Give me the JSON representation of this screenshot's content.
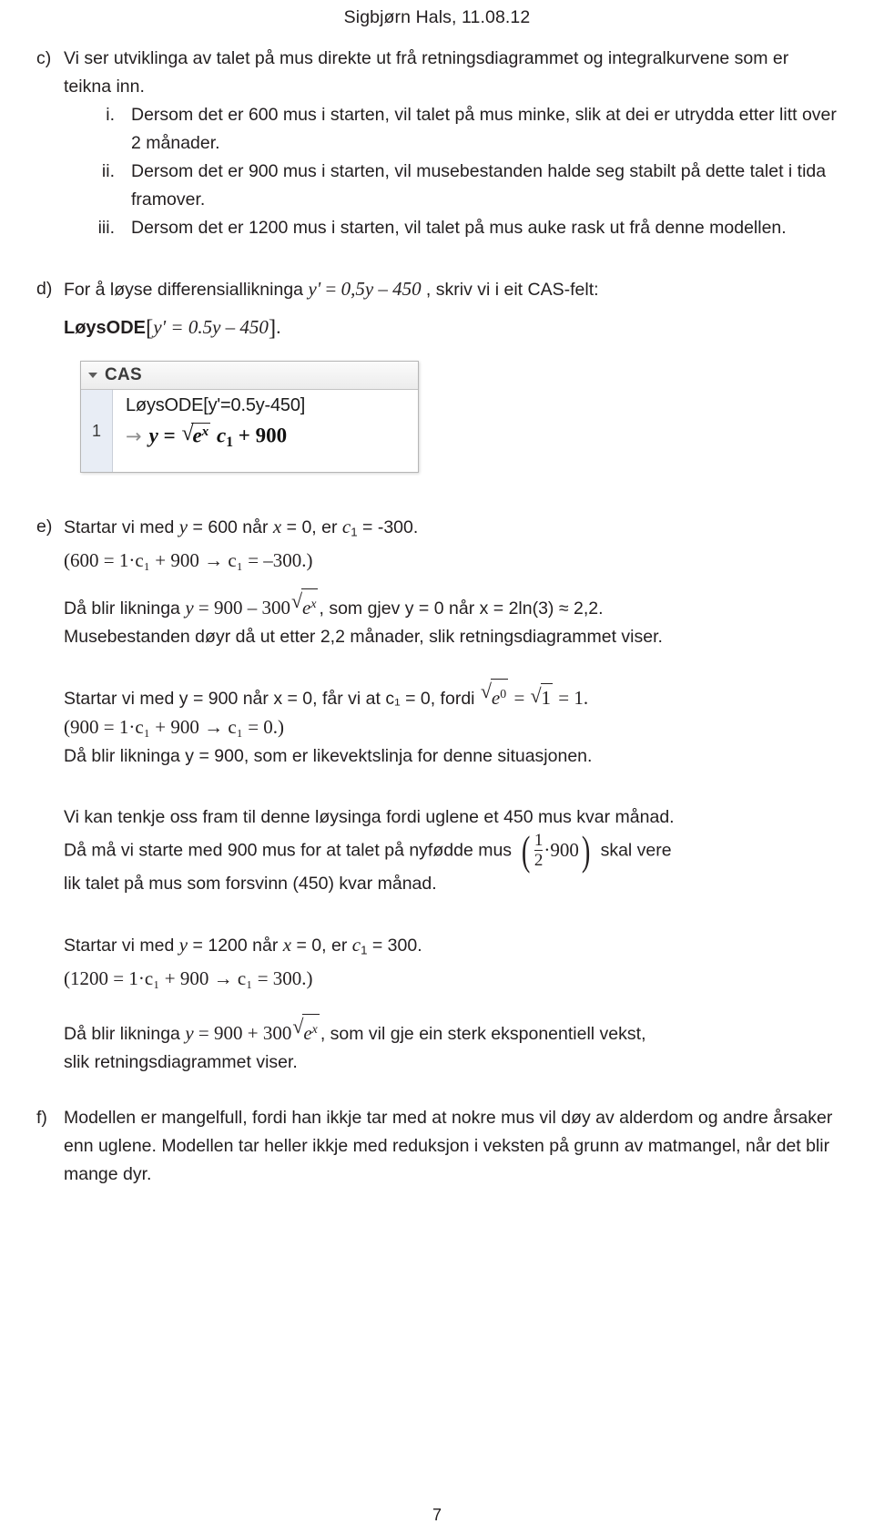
{
  "header": {
    "author_date": "Sigbjørn Hals, 11.08.12"
  },
  "sections": {
    "c": {
      "marker": "c)",
      "intro": "Vi ser utviklinga av talet på mus direkte ut frå retningsdiagrammet og integralkurvene som er teikna inn.",
      "items": [
        {
          "marker": "i.",
          "text": "Dersom det er 600 mus i starten, vil talet på mus minke, slik at dei er utrydda etter litt over 2 månader."
        },
        {
          "marker": "ii.",
          "text": "Dersom det er 900 mus i starten, vil musebestanden halde seg stabilt på dette talet i tida framover."
        },
        {
          "marker": "iii.",
          "text": "Dersom det er 1200 mus i starten, vil talet på mus auke rask ut frå denne modellen."
        }
      ]
    },
    "d": {
      "marker": "d)",
      "text_before": "For å løyse differensiallikninga",
      "equation": {
        "lhs": "y'",
        "eq": "=",
        "rhs": "0,5y – 450"
      },
      "text_after": ", skriv vi i eit CAS-felt:",
      "command_name": "LøysODE",
      "command_arg": "y' = 0.5y – 450",
      "command_suffix": "."
    },
    "cas": {
      "title": "CAS",
      "collapse_icon": "chevron-down-icon",
      "row_number": "1",
      "input": "LøysODE[y'=0.5y-450]",
      "output_arrow": "→",
      "output": {
        "lhs": "y",
        "eq": "=",
        "radicand": "e",
        "radicand_exp": "x",
        "coeff": "c",
        "coeff_sub": "1",
        "plus": "+",
        "constant": "900"
      }
    },
    "e": {
      "marker": "e)",
      "case600": {
        "line1": "Startar vi med y = 600 når x = 0, er c₁ = -300.",
        "line1_parts": {
          "a": "Startar vi med ",
          "y": "y",
          "b": " = 600 når ",
          "x": "x",
          "c": " = 0, er ",
          "c1": "c",
          "c1sub": "1",
          "d": " = -300."
        },
        "calc": "(600 = 1·c₁ + 900 → c₁ = –300.)",
        "result_pre": "Då blir likninga",
        "result_eq": "y = 900 – 300√(eˣ)",
        "result_post": ", som gjev y = 0 når x = 2ln(3) ≈ 2,2.",
        "conclusion": "Musebestanden døyr då ut etter 2,2 månader, slik retningsdiagrammet viser."
      },
      "case900": {
        "line1_pre": "Startar vi med y = 900 når x = 0, får vi at c₁ = 0, fordi",
        "line1_math": "√(e⁰) = √1 = 1.",
        "calc": "(900 = 1·c₁ + 900 → c₁ = 0.)",
        "result": "Då blir likninga y = 900, som er likevektslinja for denne situasjonen."
      },
      "explanation": {
        "line1": "Vi kan tenkje oss fram til denne løysinga fordi uglene et 450 mus kvar månad.",
        "line2_pre": "Då må vi starte med 900 mus for at talet på nyfødde mus",
        "fraction": {
          "numerator": "1",
          "denominator": "2",
          "times": "·",
          "factor": "900"
        },
        "line2_post": "skal vere",
        "line3": "lik talet på mus som forsvinn (450) kvar månad."
      },
      "case1200": {
        "line1": "Startar vi med y = 1200 når x = 0, er c₁ = 300.",
        "calc": "(1200 = 1·c₁ + 900 → c₁ = 300.)",
        "result_pre": "Då blir likninga",
        "result_eq": "y = 900 + 300√(eˣ)",
        "result_post": ", som vil gje ein sterk eksponentiell vekst,",
        "result_line2": "slik retningsdiagrammet viser."
      }
    },
    "f": {
      "marker": "f)",
      "text": "Modellen er mangelfull, fordi han ikkje tar med at nokre mus vil døy av alderdom og andre årsaker enn uglene. Modellen tar heller ikkje med reduksjon i veksten på grunn av matmangel, når det blir mange dyr."
    }
  },
  "footer": {
    "page_number": "7"
  },
  "colors": {
    "text": "#231f20",
    "cas_gutter": "#e8edf5",
    "cas_header": "#ececec",
    "cas_border": "#b6b6b6"
  }
}
